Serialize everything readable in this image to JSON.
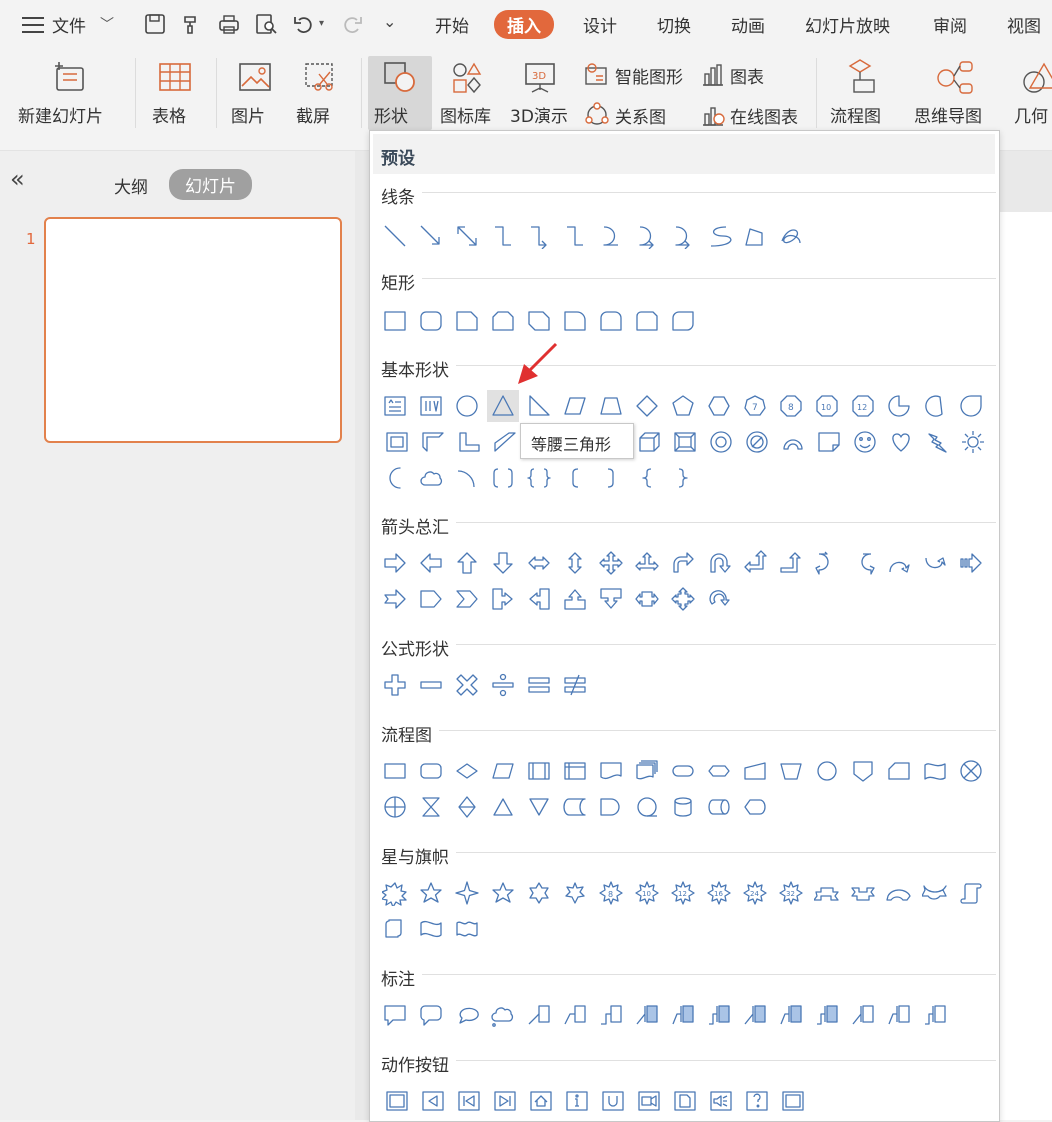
{
  "menu": {
    "file": "文件",
    "tabs": [
      "开始",
      "插入",
      "设计",
      "切换",
      "动画",
      "幻灯片放映",
      "审阅",
      "视图"
    ],
    "active_tab": "插入"
  },
  "ribbon": {
    "new_slide": "新建幻灯片",
    "table": "表格",
    "picture": "图片",
    "screenshot": "截屏",
    "shape": "形状",
    "icon_lib": "图标库",
    "demo3d": "3D演示",
    "smartart": "智能图形",
    "chart": "图表",
    "relation": "关系图",
    "online_chart": "在线图表",
    "flowchart": "流程图",
    "mindmap": "思维导图",
    "geometry": "几何"
  },
  "panel": {
    "outline": "大纲",
    "slides": "幻灯片",
    "slide_number": "1",
    "collapse_icon": "«"
  },
  "dropdown": {
    "title": "预设",
    "sections": {
      "lines": "线条",
      "rect": "矩形",
      "basic": "基本形状",
      "arrows": "箭头总汇",
      "formula": "公式形状",
      "flow": "流程图",
      "stars": "星与旗帜",
      "callouts": "标注",
      "action": "动作按钮"
    }
  },
  "tooltip": "等腰三角形",
  "colors": {
    "accent": "#e2683c",
    "shape_stroke": "#4a78b5",
    "arrow": "#e03030"
  }
}
